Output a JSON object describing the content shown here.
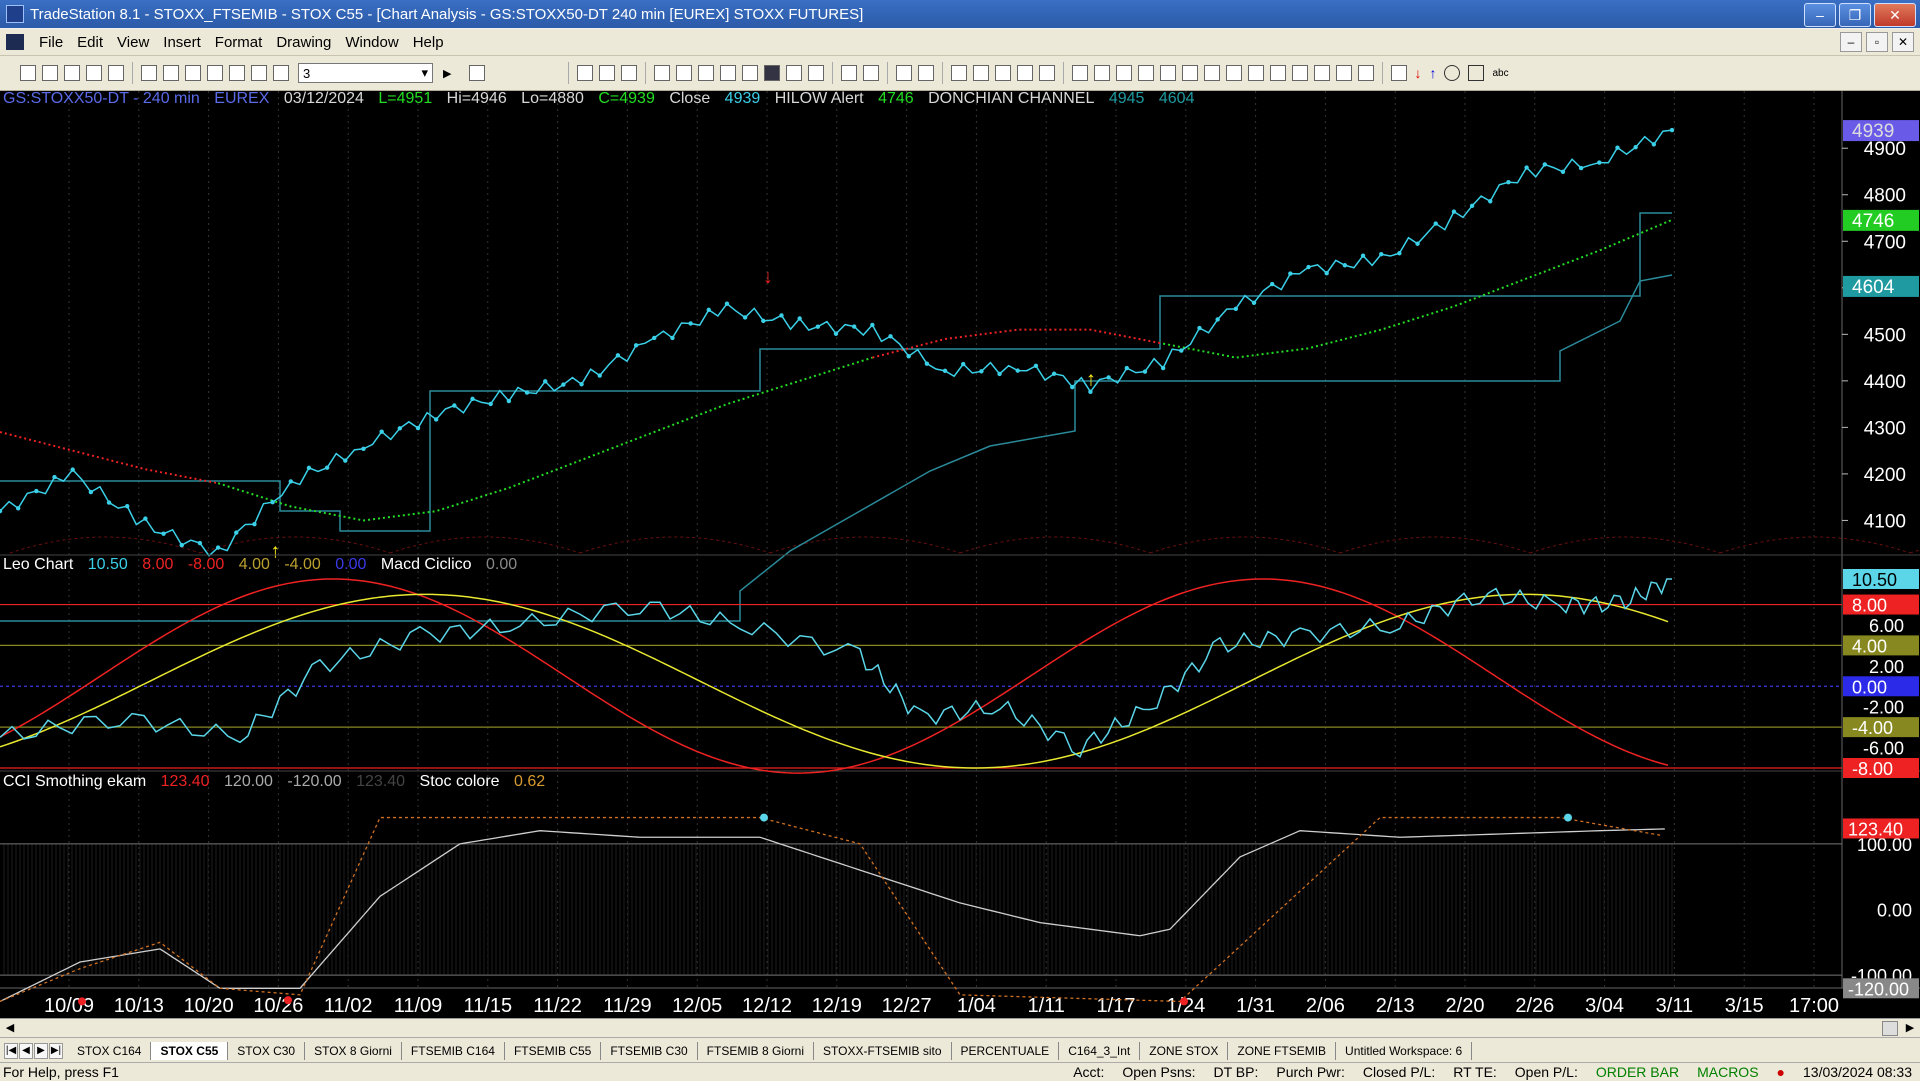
{
  "window": {
    "title": "TradeStation 8.1 - STOXX_FTSEMIB - STOX C55 - [Chart Analysis - GS:STOXX50-DT  240 min  [EUREX] STOXX FUTURES]",
    "minimize": "–",
    "maximize": "❐",
    "close": "✕"
  },
  "menu": [
    "File",
    "Edit",
    "View",
    "Insert",
    "Format",
    "Drawing",
    "Window",
    "Help"
  ],
  "child_buttons": [
    "–",
    "▫",
    "✕"
  ],
  "toolbar": {
    "select_value": "3"
  },
  "header": {
    "symbol": "GS:STOXX50-DT - 240 min",
    "exchange": "EUREX",
    "date": "03/12/2024",
    "last": "L=4951",
    "hi": "Hi=4946",
    "lo": "Lo=4880",
    "close_val": "C=4939",
    "close_label": "Close",
    "close_num": "4939",
    "hilow": "HILOW Alert",
    "hilow_num": "4746",
    "donchian": "DONCHIAN CHANNEL",
    "don_hi": "4945",
    "don_lo": "4604"
  },
  "leo": {
    "name": "Leo Chart",
    "v1": "10.50",
    "v2": "8.00",
    "v3": "-8.00",
    "v4": "4.00",
    "v5": "-4.00",
    "v6": "0.00",
    "macd": "Macd Ciclico",
    "macd_val": "0.00"
  },
  "cci": {
    "name": "CCI Smothing ekam",
    "v1": "123.40",
    "v2": "120.00",
    "v3": "-120.00",
    "v4": "123.40",
    "stoc": "Stoc colore",
    "stoc_val": "0.62"
  },
  "axis": {
    "price_ticks": [
      "4100",
      "4200",
      "4300",
      "4400",
      "4500",
      "4600",
      "4700",
      "4800",
      "4900"
    ],
    "price_boxes": [
      "4939",
      "4746",
      "4604"
    ],
    "leo_ticks": [
      "6.00",
      "2.00",
      "-2.00",
      "-6.00"
    ],
    "leo_boxes": [
      "10.50",
      "8.00",
      "4.00",
      "0.00",
      "-4.00",
      "-8.00"
    ],
    "cci_ticks": [
      "100.00",
      "0.00",
      "-100.00"
    ],
    "cci_boxes": [
      "123.40",
      "-120.00"
    ],
    "dates": [
      "10/09",
      "10/13",
      "10/20",
      "10/26",
      "11/02",
      "11/09",
      "11/15",
      "11/22",
      "11/29",
      "12/05",
      "12/12",
      "12/19",
      "12/27",
      "1/04",
      "1/11",
      "1/17",
      "1/24",
      "1/31",
      "2/06",
      "2/13",
      "2/20",
      "2/26",
      "3/04",
      "3/11",
      "3/15",
      "17:00"
    ]
  },
  "chart_data": {
    "type": "line",
    "symbol": "GS:STOXX50-DT",
    "ylim": [
      4030,
      4980
    ],
    "x": [
      "10/09",
      "10/13",
      "10/20",
      "10/26",
      "11/02",
      "11/09",
      "11/15",
      "11/22",
      "11/29",
      "12/05",
      "12/12",
      "12/19",
      "12/27",
      "1/04",
      "1/11",
      "1/17",
      "1/24",
      "1/31",
      "2/06",
      "2/13",
      "2/20",
      "2/26",
      "3/04",
      "3/11"
    ],
    "series": [
      {
        "name": "Close",
        "values": [
          4120,
          4200,
          4090,
          4030,
          4180,
          4260,
          4330,
          4370,
          4400,
          4490,
          4555,
          4520,
          4510,
          4420,
          4430,
          4390,
          4440,
          4560,
          4640,
          4660,
          4750,
          4850,
          4870,
          4939
        ]
      },
      {
        "name": "HILOW Alert",
        "values": [
          4290,
          4250,
          4210,
          4180,
          4130,
          4100,
          4120,
          4170,
          4230,
          4290,
          4350,
          4400,
          4450,
          4490,
          4510,
          4510,
          4480,
          4450,
          4470,
          4510,
          4560,
          4620,
          4680,
          4746
        ]
      },
      {
        "name": "DONCHIAN CHANNEL",
        "values": [
          4604
        ]
      }
    ],
    "markers": [
      {
        "type": "sell",
        "x": "12/12"
      },
      {
        "type": "buy",
        "x": "10/26"
      },
      {
        "type": "buy",
        "x": "1/17"
      }
    ]
  },
  "tabs": [
    "STOX C164",
    "STOX C55",
    "STOX  C30",
    "STOX  8 Giorni",
    "FTSEMIB C164",
    "FTSEMIB C55",
    "FTSEMIB C30",
    "FTSEMIB  8 Giorni",
    "STOXX-FTSEMIB sito",
    "PERCENTUALE",
    "C164_3_Int",
    "ZONE STOX",
    "ZONE FTSEMIB",
    "Untitled Workspace:  6"
  ],
  "status": {
    "help": "For Help, press F1",
    "acct": "Acct:",
    "open_psns": "Open Psns:",
    "dt_bp": "DT BP:",
    "purch_pwr": "Purch Pwr:",
    "closed_pl": "Closed P/L:",
    "rt_te": "RT TE:",
    "open_pl": "Open P/L:",
    "order_bar": "ORDER BAR",
    "macros": "MACROS",
    "datetime": "13/03/2024 08:33"
  },
  "colors": {
    "price": "#3ad0e8",
    "hilow_up": "#22dd22",
    "hilow_down": "#ee2222",
    "donchian": "#2a8a9a",
    "leo_main": "#5ad6e8",
    "leo_red": "#ee2222",
    "leo_yellow": "#e8e830",
    "hi_box": "#6a5ae8",
    "green_box": "#22cc22",
    "teal_box": "#1e9aa0"
  }
}
